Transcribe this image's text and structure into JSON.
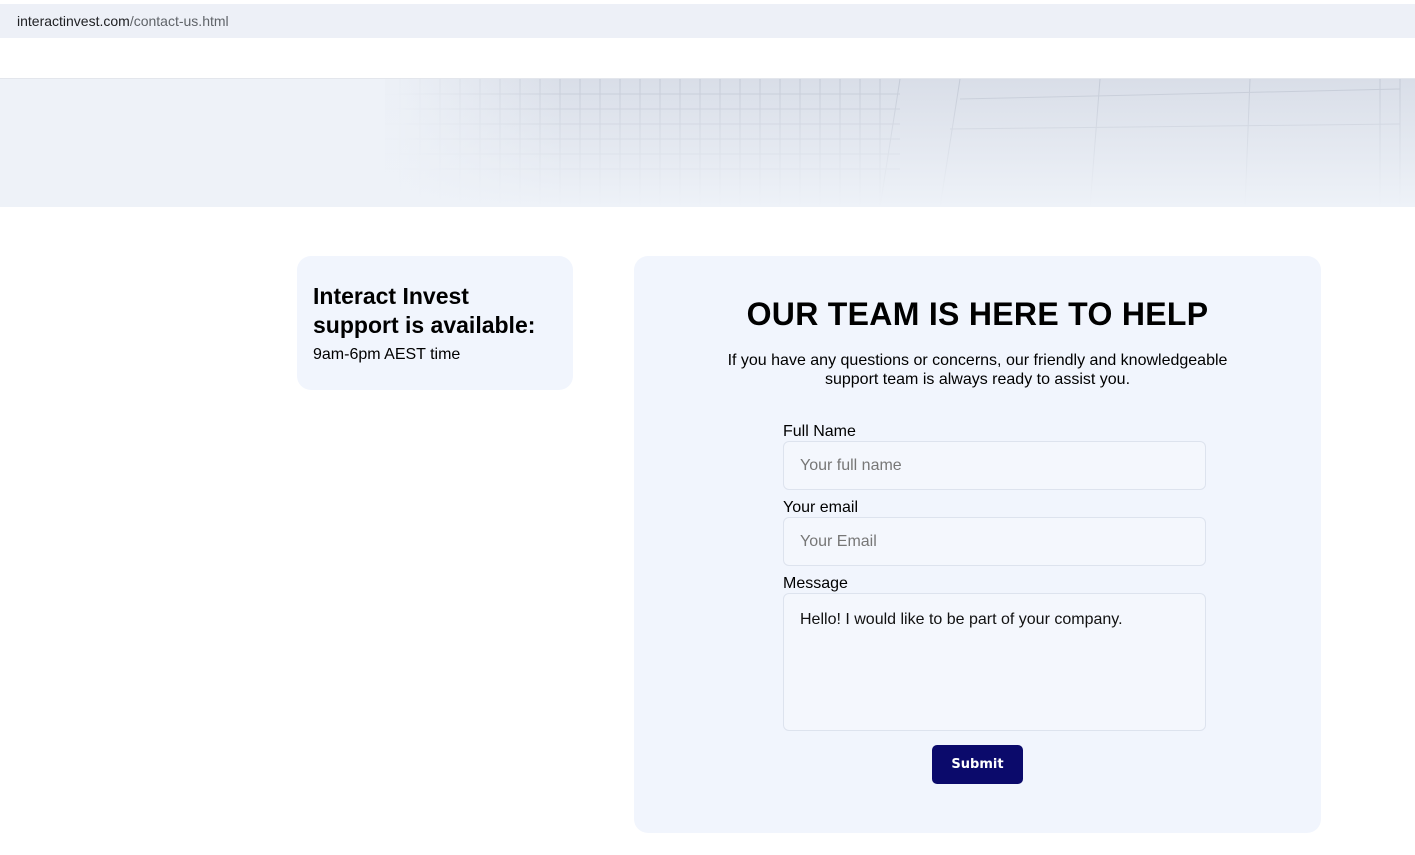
{
  "browser": {
    "url_domain": "interactinvest.com",
    "url_path": "/contact-us.html",
    "site_icon": "s"
  },
  "support": {
    "title": "Interact Invest support is available:",
    "hours": "9am-6pm AEST time"
  },
  "form": {
    "title": "OUR TEAM IS HERE TO HELP",
    "subtitle": "If you have any questions or concerns, our friendly and knowledgeable support team is always ready to assist you.",
    "full_name_label": "Full Name",
    "full_name_placeholder": "Your full name",
    "full_name_value": "",
    "email_label": "Your email",
    "email_placeholder": "Your Email",
    "email_value": "",
    "message_label": "Message",
    "message_value": "Hello! I would like to be part of your company.",
    "submit_label": "Submit"
  },
  "colors": {
    "accent": "#0b0a6b",
    "card_bg": "#f1f5fd",
    "hero_bg": "#eef2f8"
  }
}
